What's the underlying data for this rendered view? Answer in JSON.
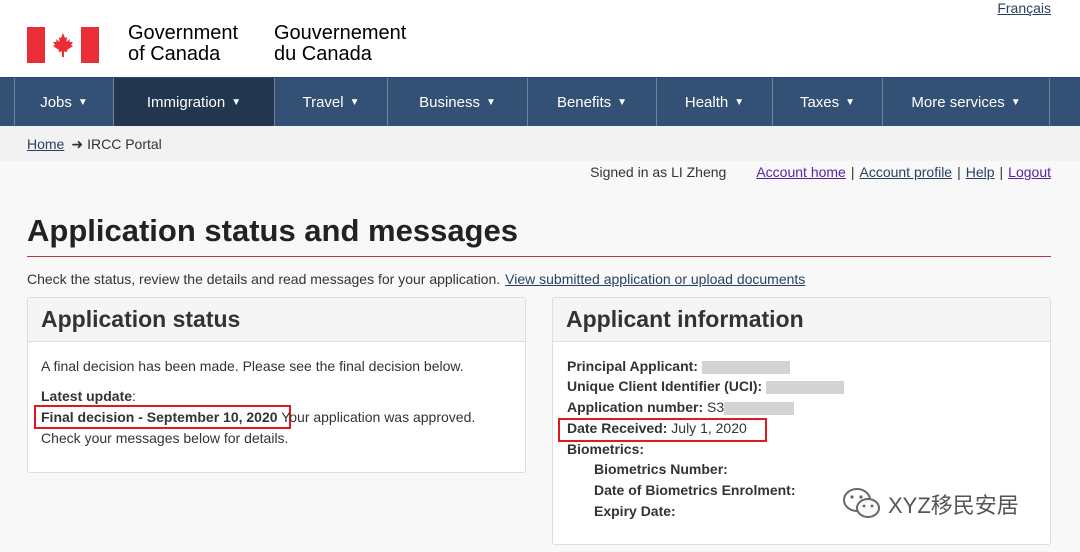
{
  "header": {
    "language_link": "Français",
    "signature_en_line1": "Government",
    "signature_en_line2": "of Canada",
    "signature_fr_line1": "Gouvernement",
    "signature_fr_line2": "du Canada"
  },
  "menu": {
    "items": [
      {
        "label": "Jobs"
      },
      {
        "label": "Immigration"
      },
      {
        "label": "Travel"
      },
      {
        "label": "Business"
      },
      {
        "label": "Benefits"
      },
      {
        "label": "Health"
      },
      {
        "label": "Taxes"
      },
      {
        "label": "More services"
      }
    ],
    "active": "Immigration"
  },
  "breadcrumb": {
    "home": "Home",
    "current": "IRCC Portal"
  },
  "account": {
    "signed_in": "Signed in as LI Zheng",
    "home": "Account home",
    "profile": "Account profile",
    "help": "Help",
    "logout": "Logout"
  },
  "page": {
    "title": "Application status and messages",
    "intro": "Check the status, review the details and read messages for your application.",
    "intro_link": "View submitted application or upload documents"
  },
  "status_panel": {
    "heading": "Application status",
    "message": "A final decision has been made. Please see the final decision below.",
    "latest_label": "Latest update",
    "latest_colon": ":",
    "decision": "Final decision - September 10, 2020",
    "decision_note": "Your application was approved.",
    "check_messages": "Check your messages below for details."
  },
  "info_panel": {
    "heading": "Applicant information",
    "principal_label": "Principal Applicant:",
    "uci_label": "Unique Client Identifier (UCI):",
    "app_number_label": "Application number:",
    "app_number_prefix": "S3",
    "date_received_label": "Date Received:",
    "date_received_value": "July 1, 2020",
    "biometrics_label": "Biometrics:",
    "biometrics_number_label": "Biometrics Number:",
    "biometrics_date_label": "Date of Biometrics Enrolment:",
    "expiry_label": "Expiry Date:"
  },
  "watermark": {
    "text": "XYZ移民安居"
  },
  "colors": {
    "menu_bg": "#335075",
    "menu_active": "#23364f",
    "title_rule": "#af3c43",
    "highlight_box": "#e0191f",
    "flag_red": "#eb2d37"
  }
}
